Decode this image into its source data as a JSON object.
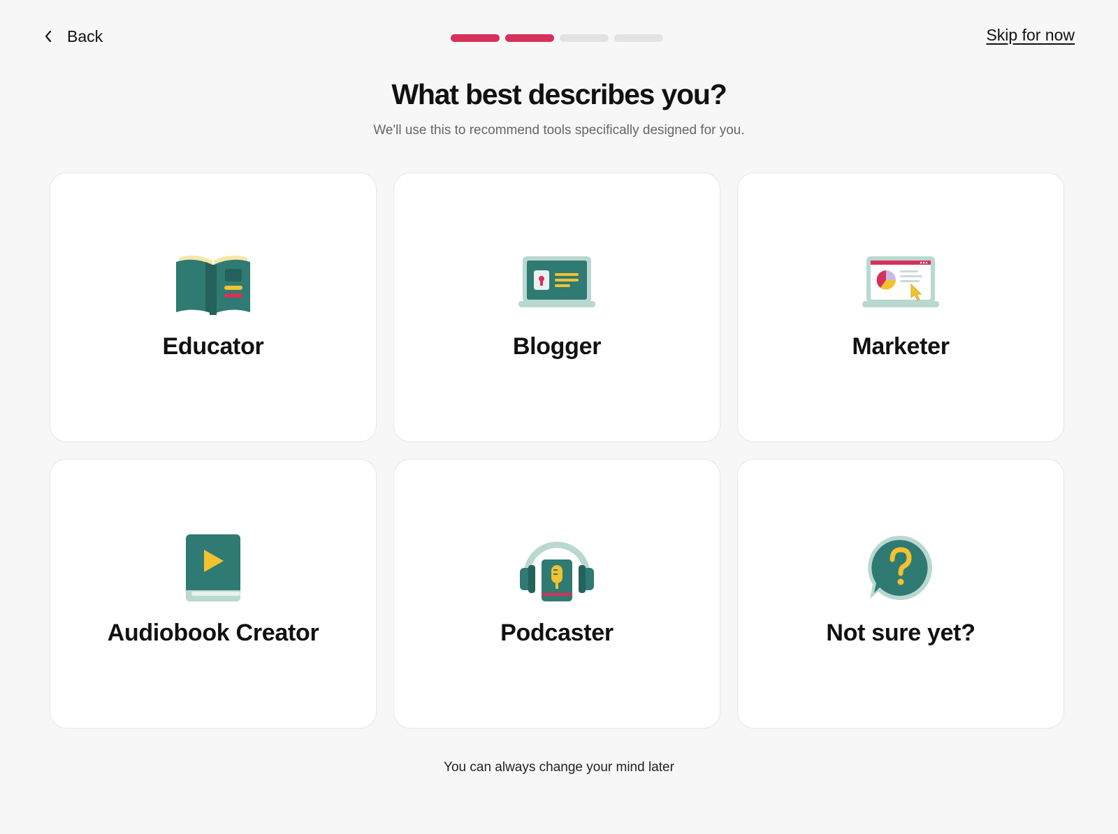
{
  "header": {
    "back_label": "Back",
    "skip_label": "Skip for now",
    "progress": {
      "completed": 2,
      "total": 4
    }
  },
  "main": {
    "title": "What best describes you?",
    "subtitle": "We'll use this to recommend tools specifically designed for you.",
    "options": [
      {
        "label": "Educator",
        "icon": "open-book-icon"
      },
      {
        "label": "Blogger",
        "icon": "laptop-blog-icon"
      },
      {
        "label": "Marketer",
        "icon": "laptop-chart-icon"
      },
      {
        "label": "Audiobook Creator",
        "icon": "play-book-icon"
      },
      {
        "label": "Podcaster",
        "icon": "headphones-mic-icon"
      },
      {
        "label": "Not sure yet?",
        "icon": "question-bubble-icon"
      }
    ]
  },
  "footer": {
    "note": "You can always change your mind later"
  },
  "colors": {
    "accent": "#d7305a",
    "teal": "#2f7a72",
    "teal_dark": "#24625b",
    "mint": "#b9d8cf",
    "yellow": "#f2c230",
    "background": "#f7f7f7"
  }
}
